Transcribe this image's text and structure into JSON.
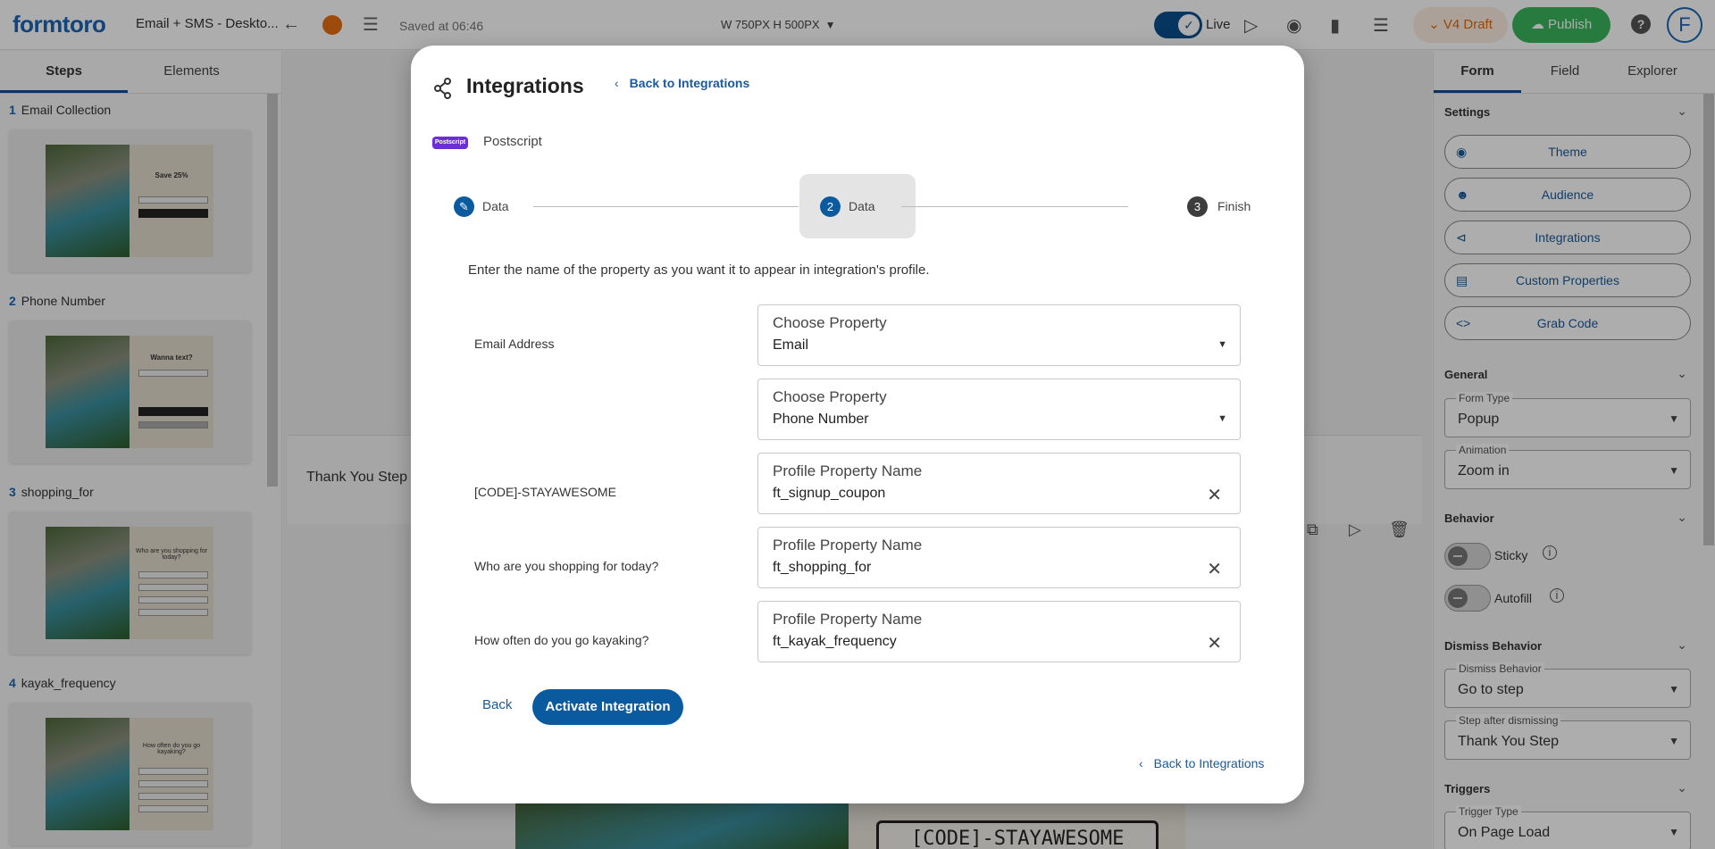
{
  "app": {
    "logo_left": "form",
    "logo_right": "toro",
    "title": "Email + SMS - Deskto...",
    "saved": "Saved at 06:46",
    "size": "W 750PX  H 500PX",
    "live_label": "Live",
    "draft_label": "V4 Draft",
    "publish_label": "Publish",
    "avatar_letter": "F",
    "help_glyph": "?"
  },
  "left": {
    "tabs": [
      "Steps",
      "Elements"
    ],
    "steps": [
      {
        "num": "1",
        "name": "Email Collection",
        "thumb_title": "Save 25%"
      },
      {
        "num": "2",
        "name": "Phone Number",
        "thumb_title": "Wanna text?"
      },
      {
        "num": "3",
        "name": "shopping_for",
        "thumb_title": "Who are you shopping for today?"
      },
      {
        "num": "4",
        "name": "kayak_frequency",
        "thumb_title": "How often do you go kayaking?"
      }
    ]
  },
  "canvas": {
    "thank_you": "Thank You Step",
    "code": "[CODE]-STAYAWESOME"
  },
  "right": {
    "tabs": [
      "Form",
      "Field",
      "Explorer"
    ],
    "settings_title": "Settings",
    "buttons": [
      "Theme",
      "Audience",
      "Integrations",
      "Custom Properties",
      "Grab Code"
    ],
    "general_title": "General",
    "form_type_label": "Form Type",
    "form_type_value": "Popup",
    "animation_label": "Animation",
    "animation_value": "Zoom in",
    "behavior_title": "Behavior",
    "sticky_label": "Sticky",
    "autofill_label": "Autofill",
    "dismiss_title": "Dismiss Behavior",
    "dismiss_label": "Dismiss Behavior",
    "dismiss_value": "Go to step",
    "after_label": "Step after dismissing",
    "after_value": "Thank You Step",
    "triggers_title": "Triggers",
    "trigger_type_label": "Trigger Type",
    "trigger_type_value": "On Page Load"
  },
  "modal": {
    "title": "Integrations",
    "back_top": "Back to Integrations",
    "badge": "Postscript",
    "integration_name": "Postscript",
    "steps": [
      {
        "label": "Data",
        "state": "done"
      },
      {
        "num": "2",
        "label": "Data",
        "state": "active"
      },
      {
        "num": "3",
        "label": "Finish",
        "state": "pending"
      }
    ],
    "description": "Enter the name of the property as you want it to appear in integration's profile.",
    "rows": [
      {
        "label": "Email Address",
        "field_label": "Choose Property",
        "value": "Email",
        "kind": "select"
      },
      {
        "label": "",
        "field_label": "Choose Property",
        "value": "Phone Number",
        "kind": "select"
      },
      {
        "label": "[CODE]-STAYAWESOME",
        "field_label": "Profile Property Name",
        "value": "ft_signup_coupon",
        "kind": "text"
      },
      {
        "label": "Who are you shopping for today?",
        "field_label": "Profile Property Name",
        "value": "ft_shopping_for",
        "kind": "text"
      },
      {
        "label": "How often do you go kayaking?",
        "field_label": "Profile Property Name",
        "value": "ft_kayak_frequency",
        "kind": "text"
      }
    ],
    "back_button": "Back",
    "activate_button": "Activate Integration",
    "back_bottom": "Back to Integrations"
  }
}
